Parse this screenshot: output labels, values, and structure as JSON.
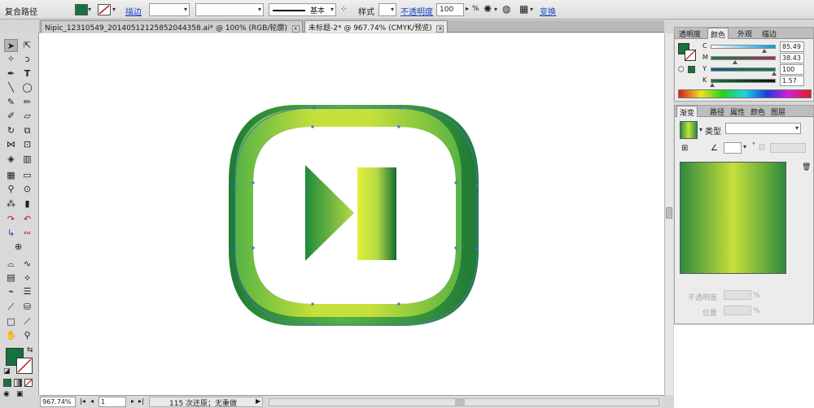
{
  "control_bar": {
    "object_type": "复合路径",
    "fill_color": "#16733d",
    "stroke_label": "描边",
    "stroke_style": "基本",
    "style_label": "样式",
    "opacity_label": "不透明度",
    "opacity_value": "100",
    "opacity_unit": "%",
    "transform_label": "变换",
    "dropdown_glyph": "▾"
  },
  "tabs": [
    {
      "label": "Nipic_12310549_20140512125852044358.ai* @ 100% (RGB/轮廓)",
      "close": "x"
    },
    {
      "label": "未标题-2* @ 967.74% (CMYK/预览)",
      "close": "x"
    }
  ],
  "status_bar": {
    "zoom": "967.74%",
    "page": "1",
    "history": "115 次还原；无重做"
  },
  "color_panel": {
    "tabs": [
      "透明度",
      "颜色",
      "外观",
      "描边"
    ],
    "active_tab": "颜色",
    "fill": "#16733d",
    "channels": [
      {
        "name": "C",
        "value": "85.49",
        "pos": 0.85
      },
      {
        "name": "M",
        "value": "38.43",
        "pos": 0.38
      },
      {
        "name": "Y",
        "value": "100",
        "pos": 1.0
      },
      {
        "name": "K",
        "value": "1.57",
        "pos": 0.02
      }
    ]
  },
  "gradient_panel": {
    "tabs": [
      "渐变",
      "路径",
      "属性",
      "颜色",
      "图层"
    ],
    "active_tab": "渐变",
    "type_label": "类型",
    "opacity_label": "不透明度",
    "position_label": "位置",
    "percent": "%",
    "angle_unit": "°",
    "stops": [
      "#2e8a3e",
      "#c7e03c",
      "#2e8a3e"
    ]
  },
  "artwork": {
    "outer_dark": "#1f7a34",
    "light": "#c6df3a",
    "mid": "#56b344",
    "play_start": "#1d8a3a",
    "play_end": "#b7db45",
    "bar_light": "#e2ee3a",
    "bar_dark": "#166a30",
    "anchor_color": "#4a6ee0"
  }
}
